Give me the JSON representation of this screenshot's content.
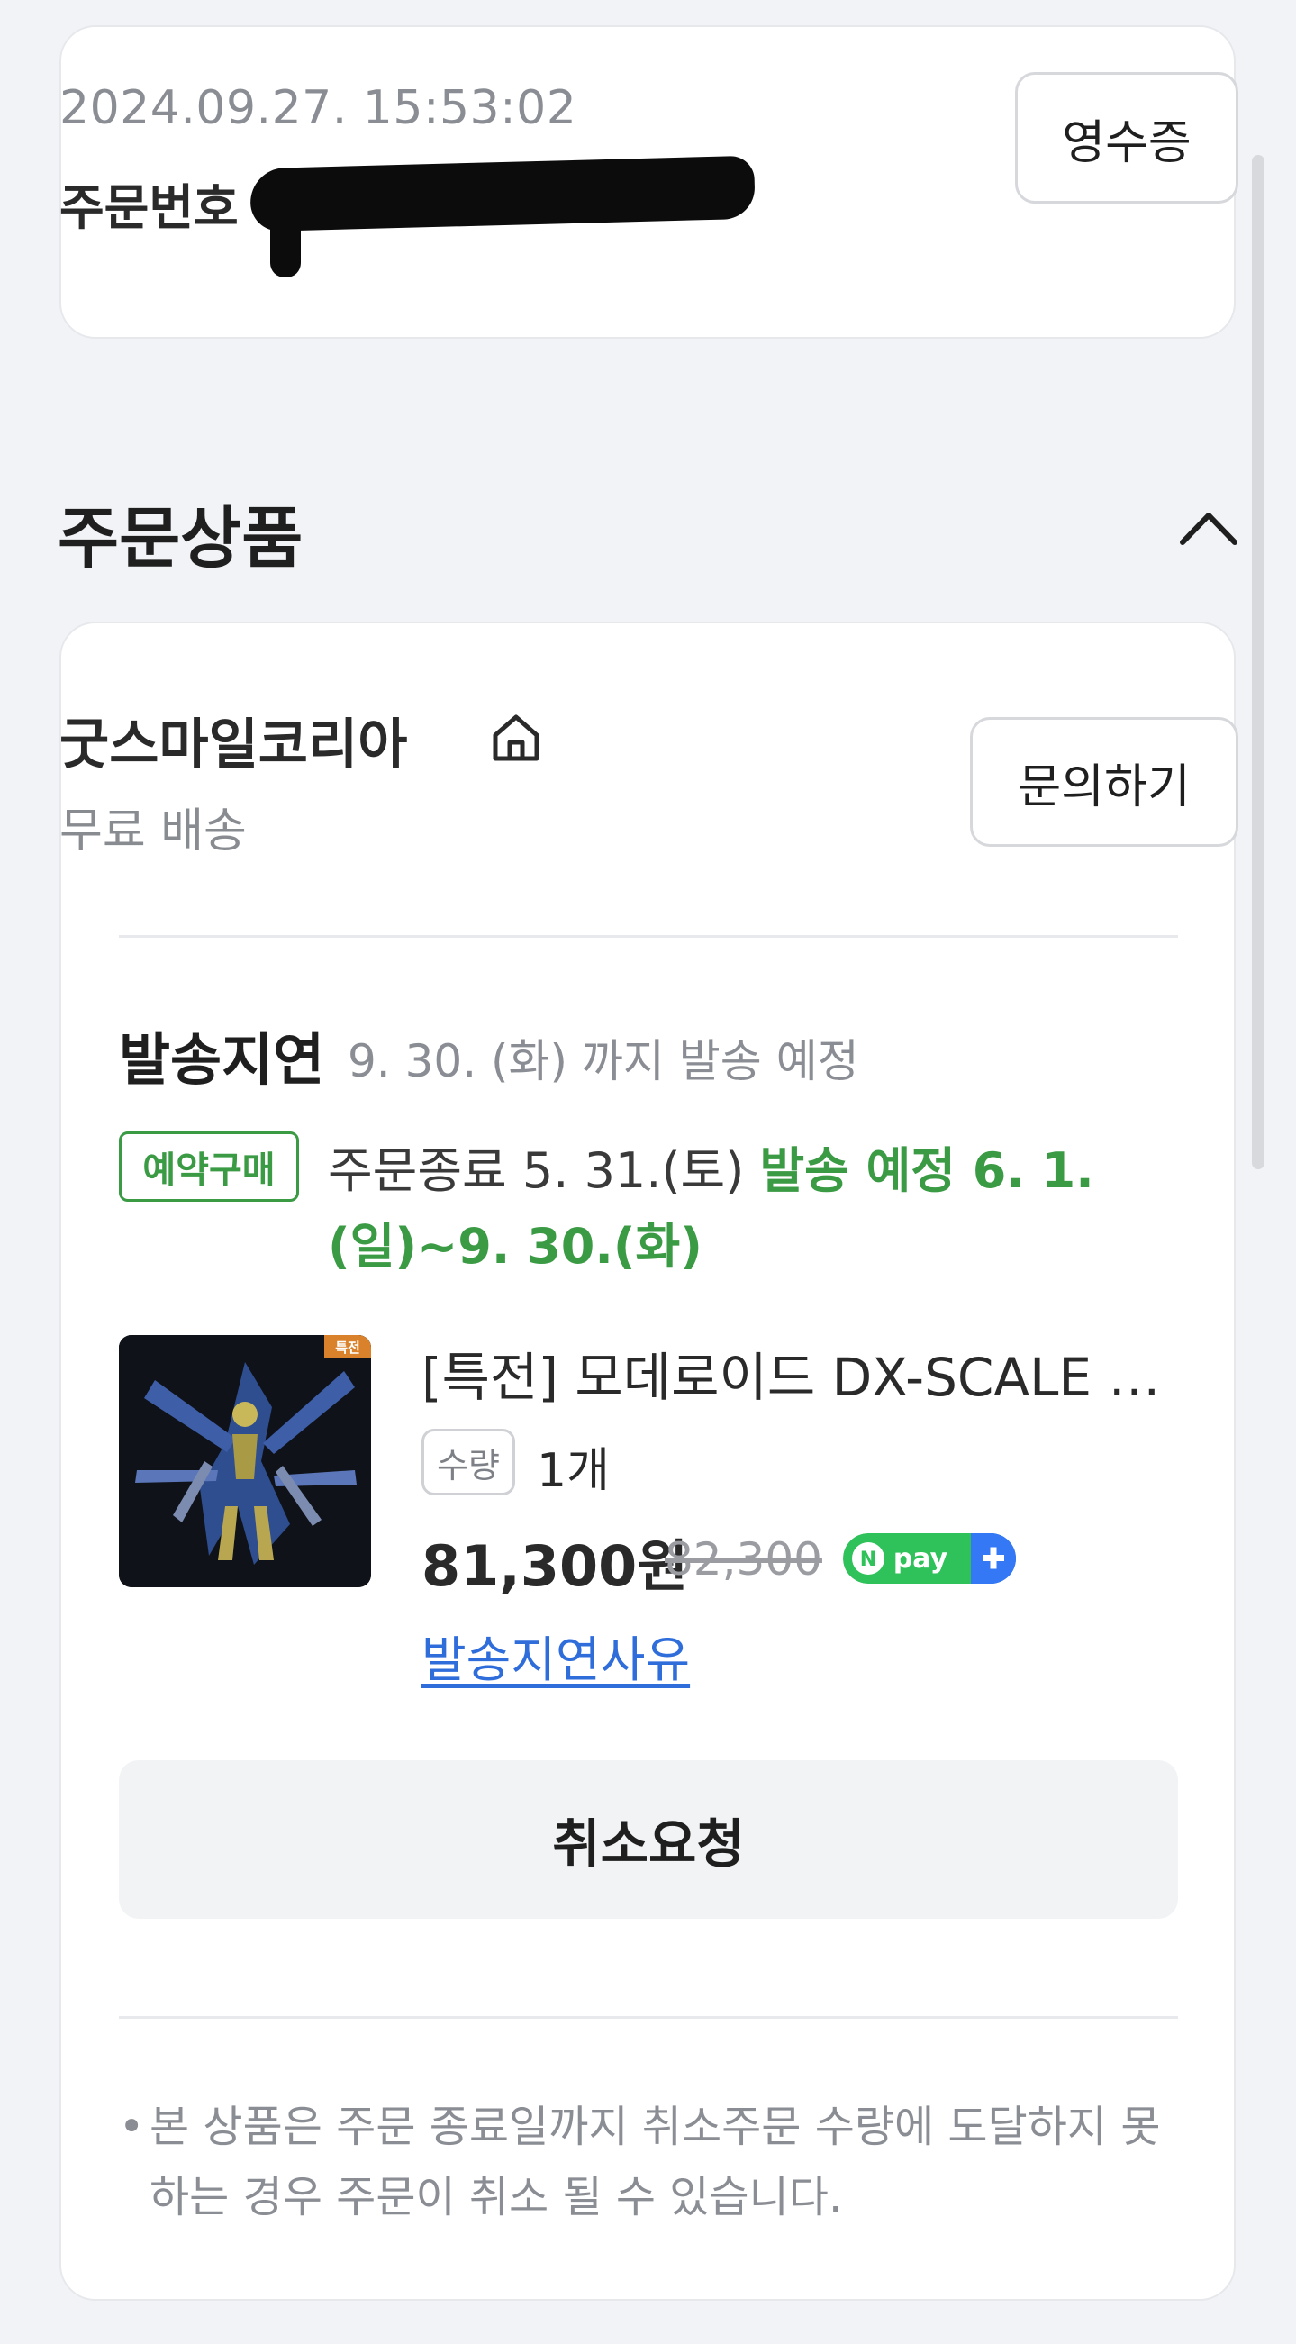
{
  "order": {
    "datetime": "2024.09.27. 15:53:02",
    "number_label": "주문번호",
    "receipt_label": "영수증"
  },
  "section": {
    "title": "주문상품",
    "toggle_icon": "chevron-up-icon"
  },
  "seller": {
    "name": "굿스마일코리아",
    "store_icon": "home-icon",
    "shipping_fee": "무료 배송",
    "inquiry_label": "문의하기"
  },
  "delay": {
    "status": "발송지연",
    "info": "9. 30. (화) 까지 발송 예정"
  },
  "preorder": {
    "badge": "예약구매",
    "close_text": "주문종료 5. 31.(토)",
    "ship_text": "발송 예정 6. 1. (일)~9. 30.(화)",
    "colors": {
      "accent": "#3b9b45"
    }
  },
  "product": {
    "image_badge": "특전",
    "name": "[특전] 모데로이드 DX-SCALE 이...",
    "qty_label": "수량",
    "qty_value": "1개",
    "price": "81,300원",
    "original_price": "82,300",
    "pay_badge": "Npay+",
    "delay_reason_link": "발송지연사유"
  },
  "actions": {
    "cancel_label": "취소요청"
  },
  "notice": {
    "bullet": "•",
    "text": "본 상품은 주문 종료일까지 취소주문 수량에 도달하지 못하는 경우 주문이 취소 될 수 있습니다."
  }
}
